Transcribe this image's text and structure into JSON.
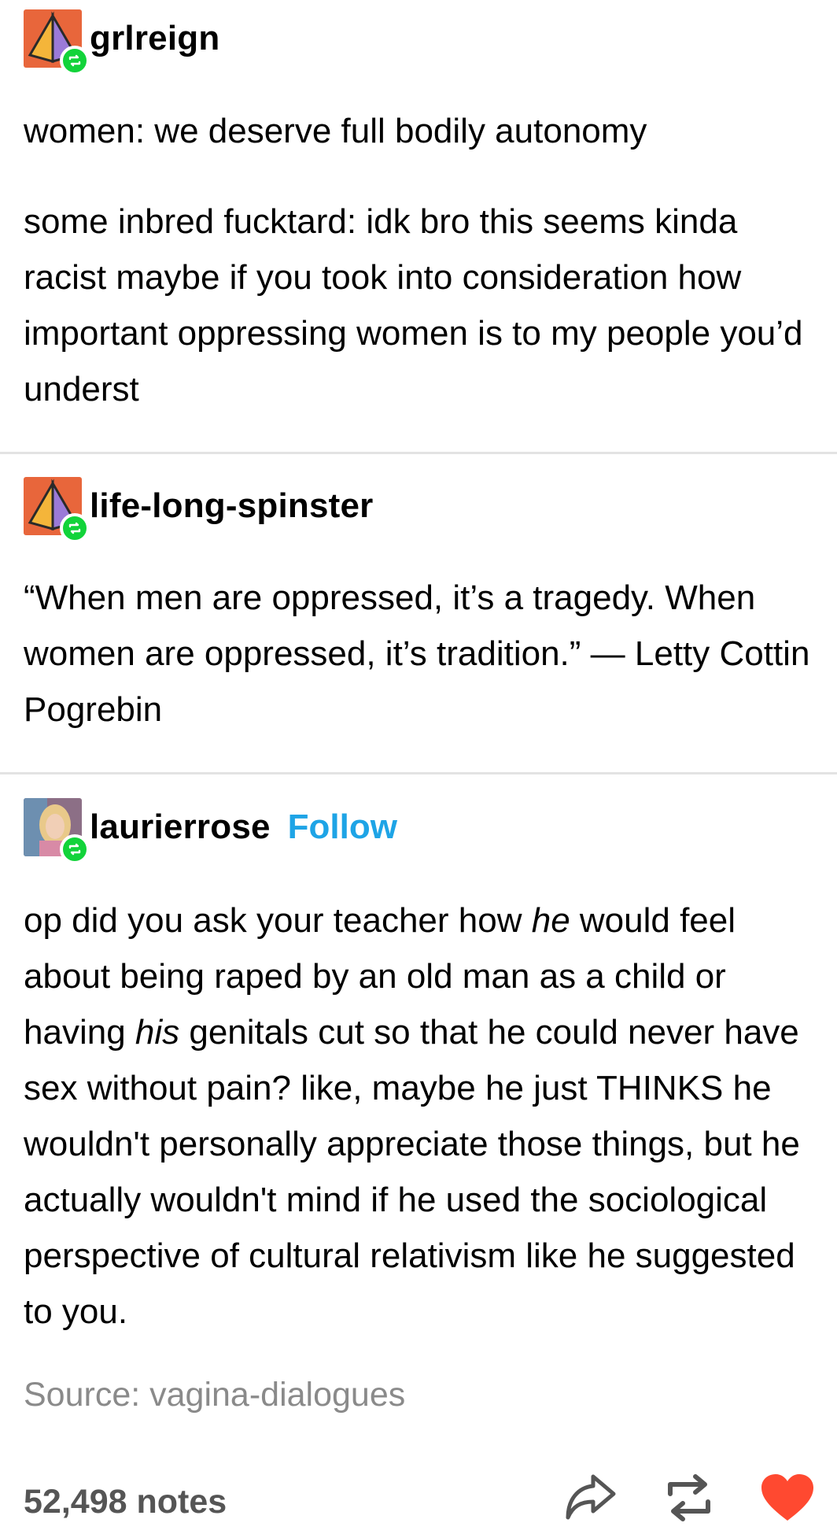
{
  "posts": [
    {
      "username": "grlreign",
      "avatar_icon": "pyramid-avatar-icon",
      "paragraphs": [
        "women: we deserve full bodily autonomy",
        "some inbred fucktard: idk bro this seems kinda racist maybe if you took into consideration how important oppressing women is to my people you’d underst"
      ]
    },
    {
      "username": "life-long-spinster",
      "avatar_icon": "pyramid-avatar-icon",
      "paragraphs": [
        "“When men are oppressed, it’s a tragedy. When women are oppressed, it’s tradition.” — Letty Cottin Pogrebin"
      ]
    },
    {
      "username": "laurierrose",
      "follow_label": "Follow",
      "avatar_icon": "photo-avatar-icon",
      "paragraph": {
        "p1": "op did you ask your teacher how ",
        "em1": "he",
        "p2": " would feel about being raped by an old man as a child or having ",
        "em2": "his",
        "p3": " genitals cut so that he could never have sex without pain? like, maybe he just THINKS he wouldn't personally appreciate those things, but he actually wouldn't mind if he used the sociological perspective of cultural relativism like he suggested to you."
      }
    }
  ],
  "source": "Source: vagina-dialogues",
  "footer": {
    "notes": "52,498 notes",
    "icons": [
      "share-icon",
      "reblog-icon",
      "like-heart-icon"
    ]
  },
  "colors": {
    "follow": "#1ea4e6",
    "reblog_badge": "#12d33a",
    "heart": "#ff4930",
    "divider": "#e3e3e3"
  }
}
